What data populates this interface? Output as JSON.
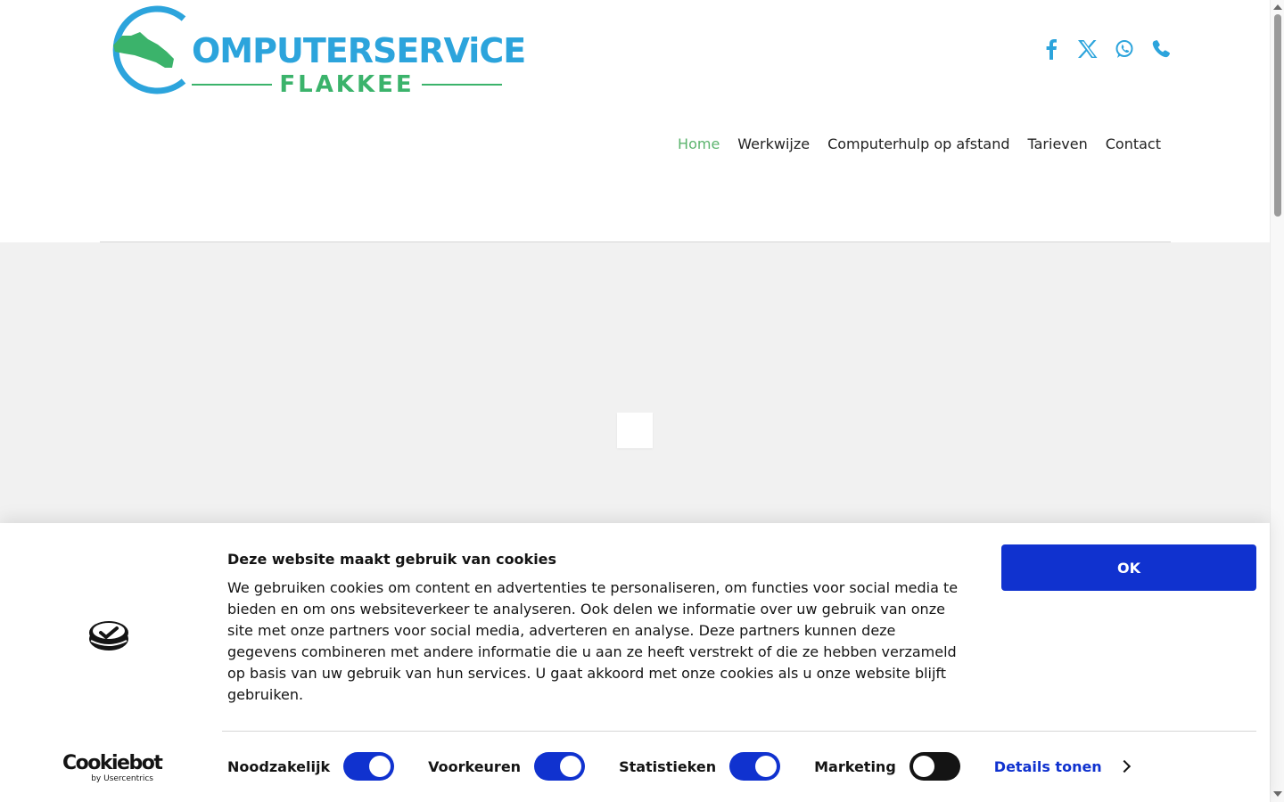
{
  "brand": {
    "name_main": "OMPUTERSERViCE",
    "name_sub": "FLAKKEE"
  },
  "social": [
    "facebook-icon",
    "x-icon",
    "whatsapp-icon",
    "phone-icon"
  ],
  "nav": [
    {
      "label": "Home",
      "active": true
    },
    {
      "label": "Werkwijze"
    },
    {
      "label": "Computerhulp op afstand"
    },
    {
      "label": "Tarieven"
    },
    {
      "label": "Contact"
    }
  ],
  "cookie": {
    "title": "Deze website maakt gebruik van cookies",
    "text": "We gebruiken cookies om content en advertenties te personaliseren, om functies voor social media te bieden en om ons websiteverkeer te analyseren. Ook delen we informatie over uw gebruik van onze site met onze partners voor social media, adverteren en analyse. Deze partners kunnen deze gegevens combineren met andere informatie die u aan ze heeft verstrekt of die ze hebben verzameld op basis van uw gebruik van hun services. U gaat akkoord met onze cookies als u onze website blijft gebruiken.",
    "ok_label": "OK",
    "toggles": [
      {
        "label": "Noodzakelijk",
        "on": true
      },
      {
        "label": "Voorkeuren",
        "on": true
      },
      {
        "label": "Statistieken",
        "on": true
      },
      {
        "label": "Marketing",
        "on": false
      }
    ],
    "details_label": "Details tonen",
    "cookiebot": {
      "brand": "Cookiebot",
      "by": "by Usercentrics"
    }
  },
  "colors": {
    "brand_blue": "#2ca4dc",
    "brand_green": "#3bb36b",
    "nav_active": "#5cb46e",
    "cookie_blue": "#1032cf"
  }
}
